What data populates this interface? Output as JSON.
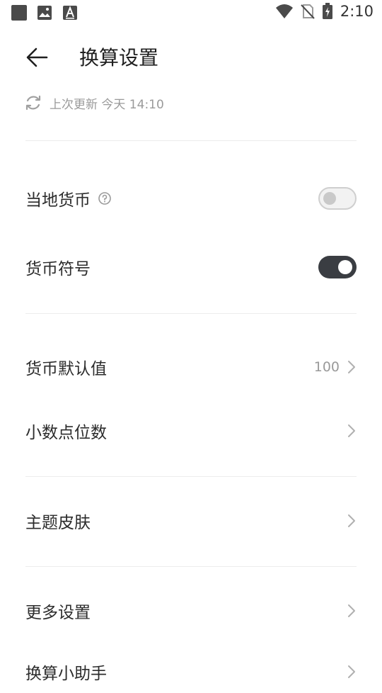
{
  "status_bar": {
    "time": "2:10"
  },
  "header": {
    "title": "换算设置"
  },
  "update": {
    "text": "上次更新 今天 14:10"
  },
  "settings": {
    "local_currency": {
      "label": "当地货币",
      "enabled": false
    },
    "currency_symbol": {
      "label": "货币符号",
      "enabled": true
    },
    "default_value": {
      "label": "货币默认值",
      "value": "100"
    },
    "decimal_places": {
      "label": "小数点位数"
    },
    "theme": {
      "label": "主题皮肤"
    },
    "more_settings": {
      "label": "更多设置"
    },
    "assistant": {
      "label": "换算小助手"
    }
  }
}
